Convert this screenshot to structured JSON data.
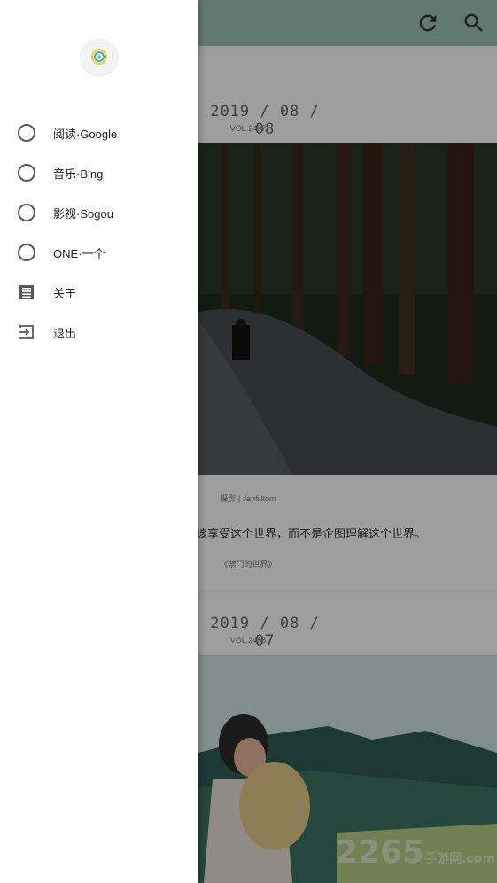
{
  "feed": {
    "post1": {
      "date": "2019 / 08 / 08",
      "vol": "VOL.2497",
      "credit": "摄影 | Janfilltom",
      "quote": "应该享受这个世界，而不是企图理解这个世界。",
      "source": "《禁门的世界》"
    },
    "post2": {
      "date": "2019 / 08 / 07",
      "vol": "VOL.2496"
    },
    "watermark": {
      "main": "2265",
      "suffix": "手游网.com"
    }
  },
  "appbar": {
    "refresh_icon": "refresh-icon",
    "search_icon": "search-icon",
    "color": "#9ec4b8"
  },
  "drawer": {
    "items": [
      {
        "label": "阅读·Google",
        "icon": "radio-unchecked-icon"
      },
      {
        "label": "音乐·Bing",
        "icon": "radio-unchecked-icon"
      },
      {
        "label": "影视·Sogou",
        "icon": "radio-unchecked-icon"
      },
      {
        "label": "ONE·一个",
        "icon": "radio-unchecked-icon"
      },
      {
        "label": "关于",
        "icon": "document-icon"
      },
      {
        "label": "退出",
        "icon": "exit-icon"
      }
    ]
  }
}
